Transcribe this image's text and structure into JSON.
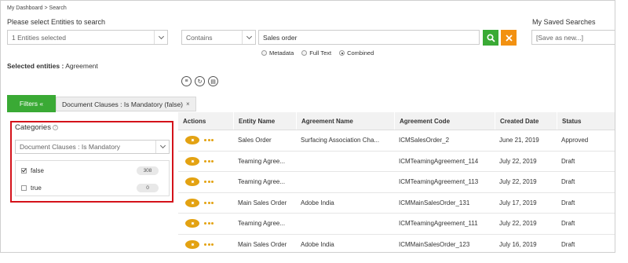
{
  "breadcrumb": {
    "home": "My Dashboard",
    "separator": ">",
    "current": "Search"
  },
  "search": {
    "prompt": "Please select Entities to search",
    "entities_value": "1 Entities selected",
    "operator_value": "Contains",
    "query_value": "Sales order",
    "search_icon": "search-icon",
    "clear_icon": "close-icon",
    "modes": [
      {
        "label": "Metadata",
        "selected": false
      },
      {
        "label": "Full Text",
        "selected": false
      },
      {
        "label": "Combined",
        "selected": true
      }
    ]
  },
  "saved_searches": {
    "title": "My Saved Searches",
    "placeholder": "[Save as new...]"
  },
  "selected_entities": {
    "label": "Selected entities :",
    "value": "Agreement"
  },
  "tools": [
    "list-icon",
    "refresh-icon",
    "export-icon"
  ],
  "filters": {
    "button_label": "Filters «",
    "chip_label": "Document Clauses : Is Mandatory (false)",
    "chip_close": "×"
  },
  "categories": {
    "title": "Categories",
    "help_icon": "question-icon",
    "select_value": "Document Clauses : Is Mandatory",
    "facets": [
      {
        "label": "false",
        "count": "308",
        "checked": true
      },
      {
        "label": "true",
        "count": "0",
        "checked": false
      }
    ]
  },
  "table": {
    "headers": [
      "Actions",
      "Entity Name",
      "Agreement Name",
      "Agreement Code",
      "Created Date",
      "Status"
    ],
    "rows": [
      [
        "",
        "Sales Order",
        "Surfacing Association Cha...",
        "ICMSalesOrder_2",
        "June 21, 2019",
        "Approved"
      ],
      [
        "",
        "Teaming Agree...",
        "",
        "ICMTeamingAgreement_114",
        "July 22, 2019",
        "Draft"
      ],
      [
        "",
        "Teaming Agree...",
        "",
        "ICMTeamingAgreement_113",
        "July 22, 2019",
        "Draft"
      ],
      [
        "",
        "Main Sales Order",
        "Adobe India",
        "ICMMainSalesOrder_131",
        "July 17, 2019",
        "Draft"
      ],
      [
        "",
        "Teaming Agree...",
        "",
        "ICMTeamingAgreement_111",
        "July 22, 2019",
        "Draft"
      ],
      [
        "",
        "Main Sales Order",
        "Adobe India",
        "ICMMainSalesOrder_123",
        "July 16, 2019",
        "Draft"
      ]
    ]
  },
  "colors": {
    "accent_green": "#3aaa35",
    "clear_orange": "#f29111",
    "action_orange": "#e3a212",
    "highlight_red": "#d4121a"
  }
}
